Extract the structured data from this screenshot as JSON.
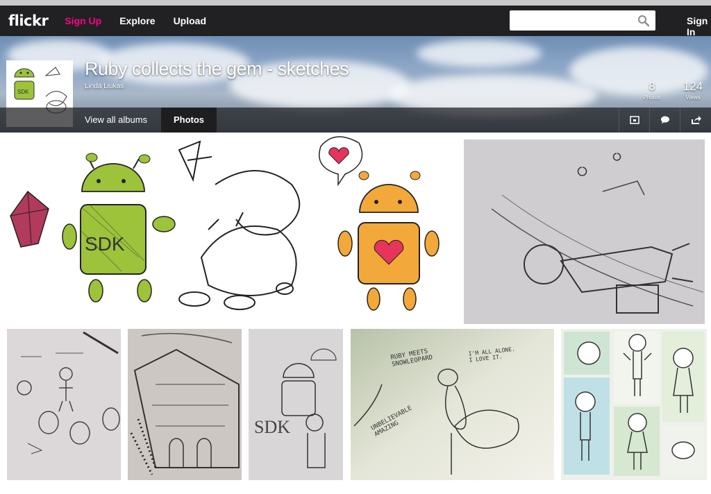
{
  "nav": {
    "logo": "flickr",
    "signup": "Sign Up",
    "explore": "Explore",
    "upload": "Upload",
    "search_placeholder": "",
    "signin": "Sign In"
  },
  "album": {
    "title": "Ruby collects the gem - sketches",
    "owner": "Linda Liukas",
    "photos_count": "8",
    "photos_label": "Photos",
    "views_count": "124",
    "views_label": "Views"
  },
  "subnav": {
    "view_all_albums": "View all albums",
    "photos": "Photos"
  },
  "sketch_texts": {
    "ruby_meets": "RUBY MEETS SNOWLEOPARD",
    "alone": "I'M ALL ALONE. I LOVE IT.",
    "unbelievable": "UNBELIEVABLE AMAZING",
    "sdk": "SDK"
  },
  "colors": {
    "nav_bg": "#212124",
    "signup": "#ff0084",
    "android_green": "#9cc33a",
    "android_orange": "#f3a93a",
    "heart": "#e6345c"
  }
}
